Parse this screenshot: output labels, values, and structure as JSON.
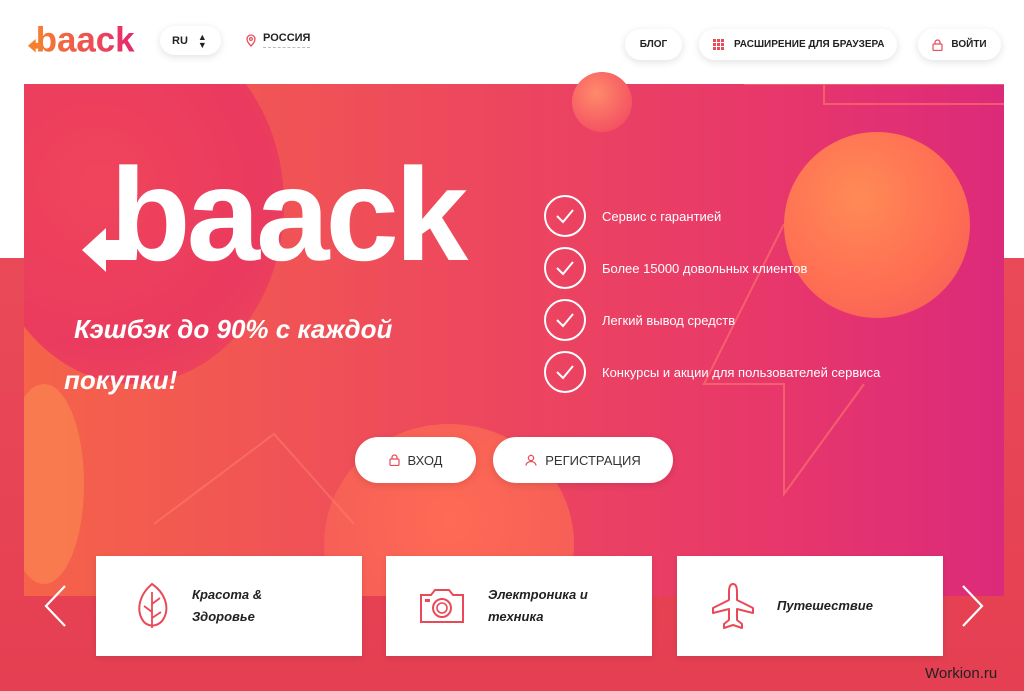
{
  "header": {
    "brand": "baack",
    "lang": "RU",
    "region": "РОССИЯ",
    "blog": "БЛОГ",
    "extension": "РАСШИРЕНИЕ ДЛЯ БРАУЗЕРА",
    "login": "ВОЙТИ"
  },
  "hero": {
    "brand": "baack",
    "slogan_line1": "Кэшбэк до 90% с каждой",
    "slogan_line2": "покупки!",
    "features": [
      "Сервис с гарантией",
      "Более 15000 довольных клиентов",
      "Легкий вывод средств",
      "Конкурсы и акции для пользователей сервиса"
    ],
    "btn_login": "ВХОД",
    "btn_register": "РЕГИСТРАЦИЯ"
  },
  "categories": [
    {
      "line1": "Красота &",
      "line2": "Здоровье",
      "icon": "leaf-icon"
    },
    {
      "line1": "Электроника и",
      "line2": "техника",
      "icon": "camera-icon"
    },
    {
      "line1": "Путешествие",
      "line2": "",
      "icon": "airplane-icon"
    }
  ],
  "watermark": "Workion.ru",
  "colors": {
    "accent": "#ee4b5b",
    "orange": "#f5634a",
    "magenta": "#dc2a7a"
  }
}
